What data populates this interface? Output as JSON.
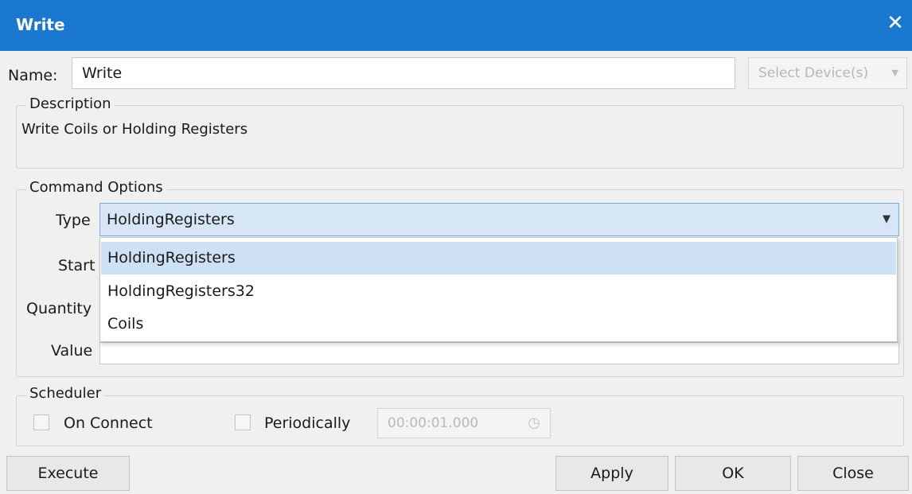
{
  "window": {
    "title": "Write",
    "close_glyph": "✕"
  },
  "name_row": {
    "label": "Name:",
    "value": "Write",
    "device_select": {
      "value": "Select Device(s)",
      "arrow": "▼"
    }
  },
  "description": {
    "label": "Description",
    "text": "Write Coils or Holding Registers"
  },
  "command_options": {
    "label": "Command Options",
    "type_label": "Type",
    "type_value": "HoldingRegisters",
    "type_arrow": "▼",
    "start_label": "Start",
    "quantity_label": "Quantity",
    "value_label": "Value",
    "dropdown_options": [
      {
        "label": "HoldingRegisters",
        "selected": true
      },
      {
        "label": "HoldingRegisters32",
        "selected": false
      },
      {
        "label": "Coils",
        "selected": false
      }
    ]
  },
  "scheduler": {
    "label": "Scheduler",
    "on_connect_label": "On Connect",
    "on_connect_checked": false,
    "periodically_label": "Periodically",
    "periodically_checked": false,
    "interval_value": "00:00:01.000",
    "clock_icon": "clock-icon"
  },
  "buttons": {
    "execute": "Execute",
    "apply": "Apply",
    "ok": "OK",
    "close": "Close"
  },
  "colors": {
    "title_bar": "#1a78d0",
    "selection": "#cde0f4"
  }
}
